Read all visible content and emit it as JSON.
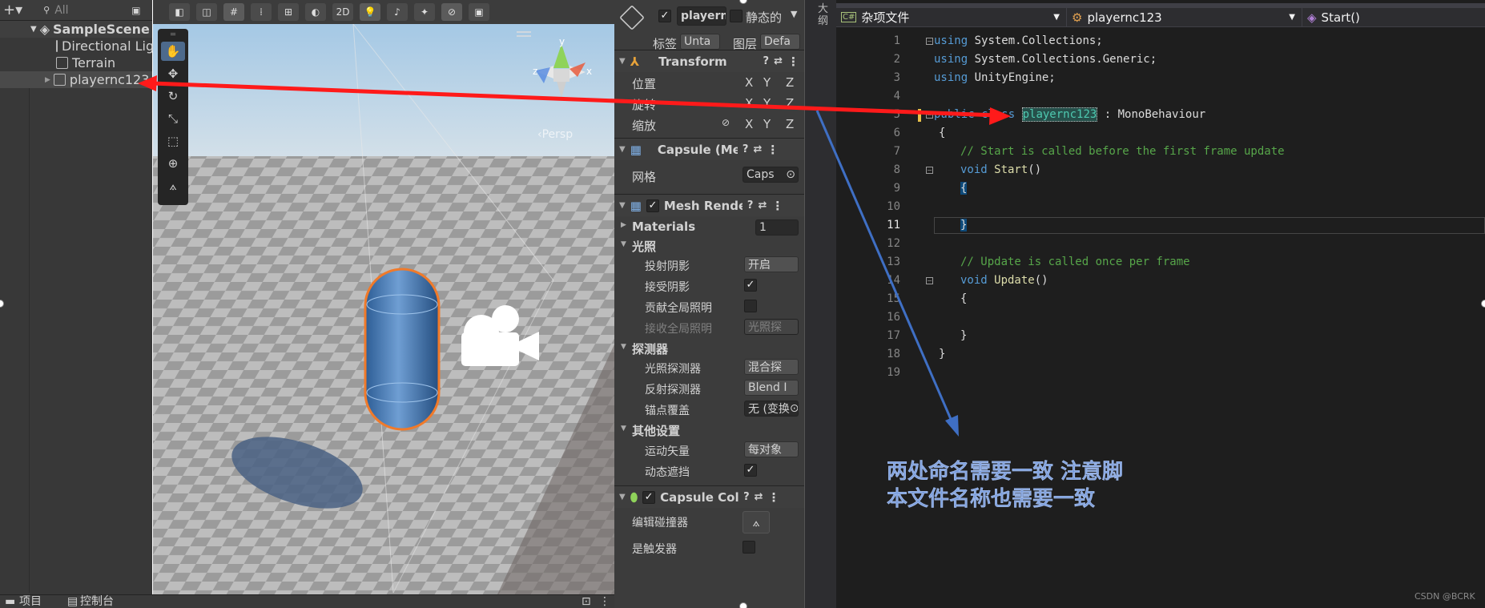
{
  "hierarchy": {
    "search_placeholder": "All",
    "scene_name": "SampleScene",
    "items": [
      "Directional Lig",
      "Terrain",
      "playernc123"
    ]
  },
  "scene": {
    "mode_2d": "2D",
    "persp_label": "‹Persp",
    "gizmo_axes": {
      "x": "x",
      "y": "y",
      "z": "z"
    }
  },
  "inspector": {
    "object_name": "playern",
    "static_label": "静态的",
    "tag_label": "标签",
    "tag_value": "Unta",
    "layer_label": "图层",
    "layer_value": "Defa",
    "transform": {
      "title": "Transform",
      "rows": [
        "位置",
        "旋转",
        "缩放"
      ],
      "axes": [
        "X",
        "Y",
        "Z"
      ]
    },
    "mesh_filter": {
      "title": "Capsule (Me:",
      "mesh_label": "网格",
      "mesh_value": "Caps"
    },
    "mesh_renderer": {
      "title": "Mesh Render",
      "materials_label": "Materials",
      "materials_count": "1",
      "lighting_section": "光照",
      "cast_shadows_label": "投射阴影",
      "cast_shadows_value": "开启",
      "receive_shadows_label": "接受阴影",
      "contribute_gi_label": "贡献全局照明",
      "receive_gi_label": "接收全局照明",
      "receive_gi_value": "光照探",
      "probes_section": "探测器",
      "light_probes_label": "光照探测器",
      "light_probes_value": "混合探",
      "reflection_probes_label": "反射探测器",
      "reflection_probes_value": "Blend I",
      "anchor_override_label": "锚点覆盖",
      "anchor_override_value": "无 (变换",
      "other_section": "其他设置",
      "motion_vectors_label": "运动矢量",
      "motion_vectors_value": "每对象",
      "dynamic_occlusion_label": "动态遮挡"
    },
    "collider": {
      "title": "Capsule Colli",
      "edit_label": "编辑碰撞器",
      "trigger_label": "是触发器"
    }
  },
  "bottom_tabs": [
    "项目",
    "控制台"
  ],
  "outline_label": "大纲",
  "editor": {
    "nav": [
      "杂项文件",
      "playernc123",
      "Start()"
    ],
    "line_numbers": [
      "1",
      "2",
      "3",
      "4",
      "5",
      "6",
      "7",
      "8",
      "9",
      "10",
      "11",
      "12",
      "13",
      "14",
      "15",
      "16",
      "17",
      "18",
      "19"
    ],
    "lines": {
      "l1a": "using",
      "l1b": " System.Collections;",
      "l2a": "using",
      "l2b": " System.Collections.Generic;",
      "l3a": "using",
      "l3b": " UnityEngine;",
      "l5a": "public",
      "l5b": " class ",
      "l5c": "playernc123",
      "l5d": " : MonoBehaviour",
      "l6": "{",
      "l7": "// Start is called before the first frame update",
      "l8a": "void",
      "l8b": " Start",
      "l8c": "()",
      "l9": "{",
      "l11": "}",
      "l13": "// Update is called once per frame",
      "l14a": "void",
      "l14b": " Update",
      "l14c": "()",
      "l15": "{",
      "l17": "}",
      "l18": "}"
    }
  },
  "annotation": [
    "两处命名需要一致 注意脚",
    "本文件名称也需要一致"
  ],
  "watermark": "CSDN @BCRK",
  "colors": {
    "arrow_red": "#ff1a1a",
    "arrow_blue": "#3f6fc4",
    "note_text": "#6f95d9"
  }
}
